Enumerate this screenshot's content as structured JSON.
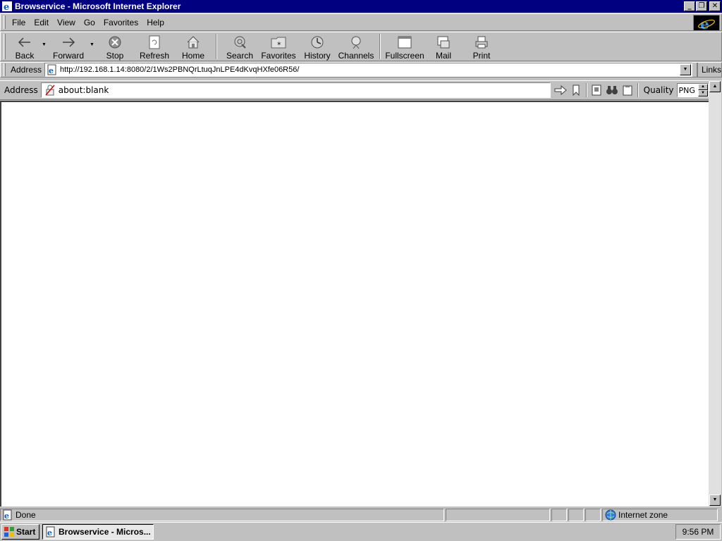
{
  "window": {
    "title": "Browservice - Microsoft Internet Explorer",
    "minimize_label": "_",
    "restore_label": "❐",
    "close_label": "✕"
  },
  "menubar": {
    "items": [
      "File",
      "Edit",
      "View",
      "Go",
      "Favorites",
      "Help"
    ]
  },
  "toolbar": {
    "buttons": [
      {
        "label": "Back",
        "icon": "back-arrow-icon"
      },
      {
        "label": "Forward",
        "icon": "forward-arrow-icon"
      },
      {
        "label": "Stop",
        "icon": "stop-icon"
      },
      {
        "label": "Refresh",
        "icon": "refresh-icon"
      },
      {
        "label": "Home",
        "icon": "home-icon"
      },
      {
        "label": "Search",
        "icon": "search-globe-icon"
      },
      {
        "label": "Favorites",
        "icon": "favorites-folder-icon"
      },
      {
        "label": "History",
        "icon": "history-icon"
      },
      {
        "label": "Channels",
        "icon": "channels-icon"
      },
      {
        "label": "Fullscreen",
        "icon": "fullscreen-icon"
      },
      {
        "label": "Mail",
        "icon": "mail-icon"
      },
      {
        "label": "Print",
        "icon": "print-icon"
      }
    ]
  },
  "addressbar": {
    "label": "Address",
    "url": "http://192.168.1.14:8080/2/1Ws2PBNQrLtuqJnLPE4dKvqHXfe06R56/",
    "links_label": "Links"
  },
  "browservice": {
    "address_label": "Address",
    "url": "about:blank",
    "quality_label": "Quality",
    "quality_value": "PNG"
  },
  "statusbar": {
    "status_text": "Done",
    "zone_text": "Internet zone"
  },
  "taskbar": {
    "start_label": "Start",
    "task_label": "Browservice - Micros...",
    "clock": "9:56 PM"
  },
  "colors": {
    "titlebar": "#000080",
    "face": "#c0c0c0",
    "content": "#ffffff"
  }
}
